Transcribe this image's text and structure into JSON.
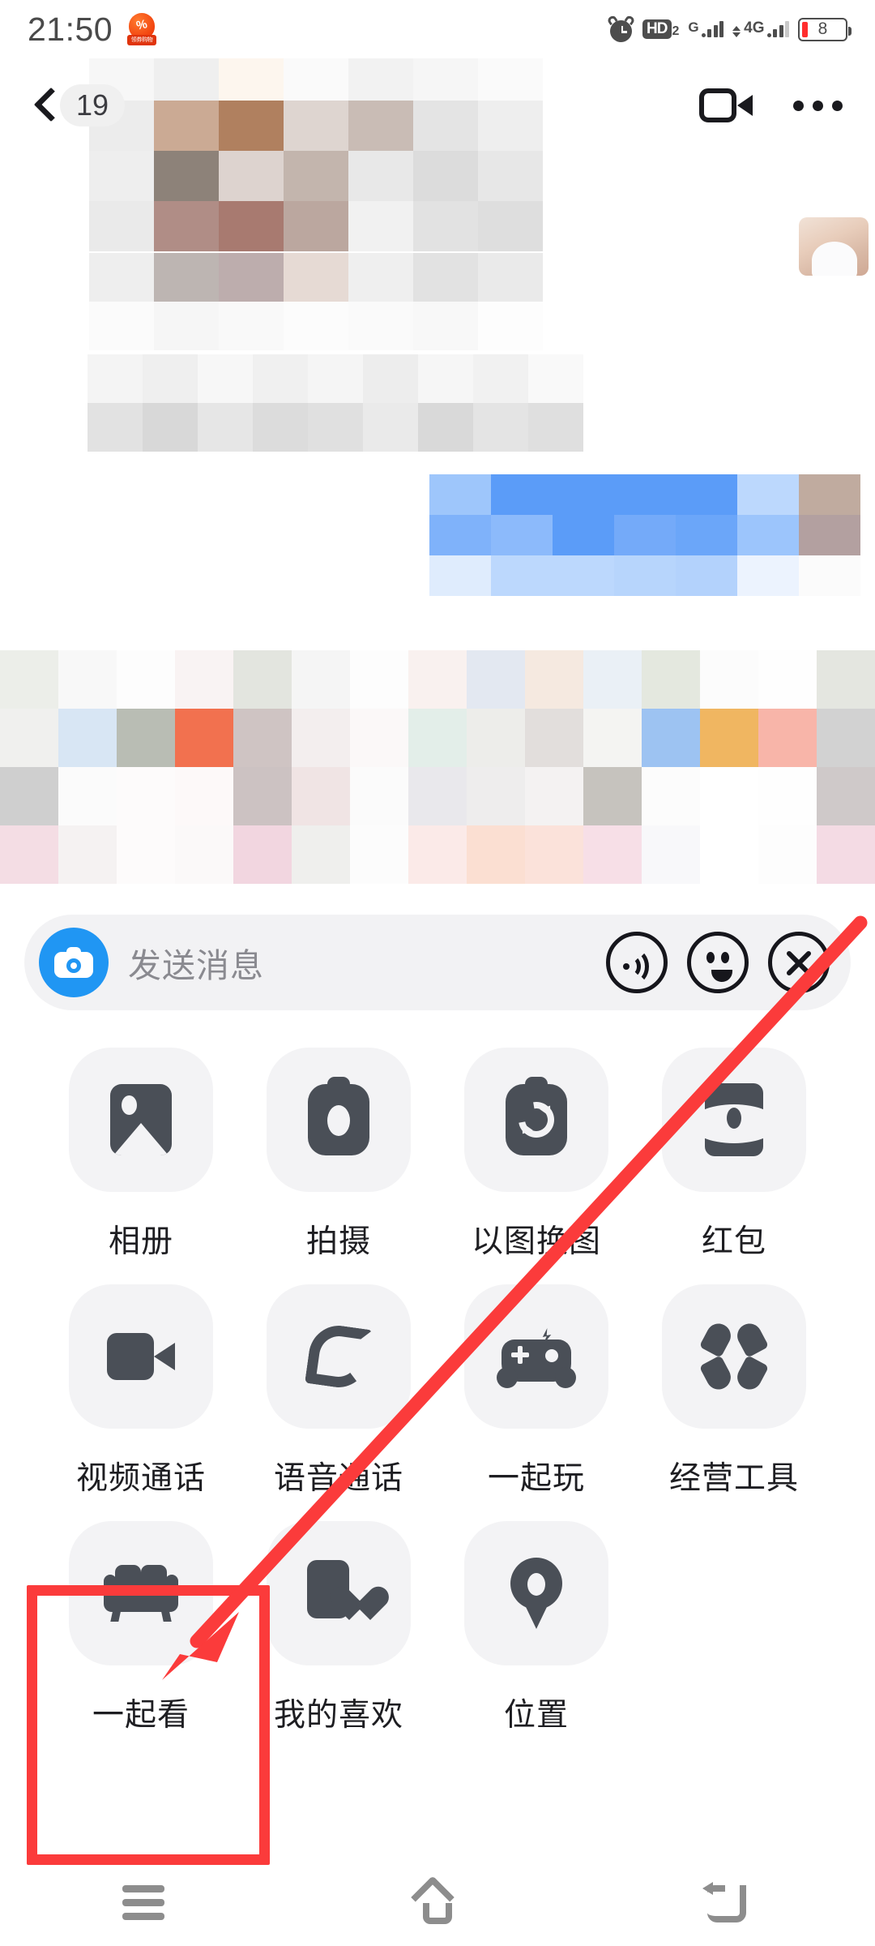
{
  "status_bar": {
    "time": "21:50",
    "app_badge_text": "领券购物",
    "alarm_icon": "alarm-clock-icon",
    "hd_label": "HD",
    "hd_sub": "2",
    "signal1_label": "G",
    "signal2_label": "4G",
    "battery_level": "8"
  },
  "chat_header": {
    "back_icon": "chevron-left-icon",
    "unread_count": "19",
    "video_call_icon": "video-camera-icon",
    "more_icon": "more-horizontal-icon"
  },
  "input_bar": {
    "camera_icon": "camera-icon",
    "placeholder": "发送消息",
    "voice_icon": "sound-wave-icon",
    "emoji_icon": "smiley-face-icon",
    "close_icon": "close-x-icon"
  },
  "app_grid": {
    "rows": [
      [
        {
          "label": "相册",
          "icon": "photo-album-icon"
        },
        {
          "label": "拍摄",
          "icon": "camera-shoot-icon"
        },
        {
          "label": "以图换图",
          "icon": "image-swap-icon"
        },
        {
          "label": "红包",
          "icon": "red-packet-icon"
        }
      ],
      [
        {
          "label": "视频通话",
          "icon": "video-call-icon"
        },
        {
          "label": "语音通话",
          "icon": "phone-call-icon"
        },
        {
          "label": "一起玩",
          "icon": "gamepad-icon"
        },
        {
          "label": "经营工具",
          "icon": "business-tools-icon"
        }
      ],
      [
        {
          "label": "一起看",
          "icon": "sofa-watch-together-icon"
        },
        {
          "label": "我的喜欢",
          "icon": "favorites-heart-icon"
        },
        {
          "label": "位置",
          "icon": "location-pin-icon"
        }
      ]
    ]
  },
  "annotation": {
    "highlight_color": "#fb3b3b",
    "highlight_target": "一起看",
    "arrow_icon": "red-arrow-pointer"
  },
  "nav_bar": {
    "recents_icon": "recents-menu-icon",
    "home_icon": "home-icon",
    "back_icon": "back-arrow-icon"
  },
  "colors": {
    "accent_blue": "#2096f3",
    "tile_bg": "#f3f3f5",
    "icon_dark": "#4a4f57",
    "annotation_red": "#fb3b3b"
  }
}
